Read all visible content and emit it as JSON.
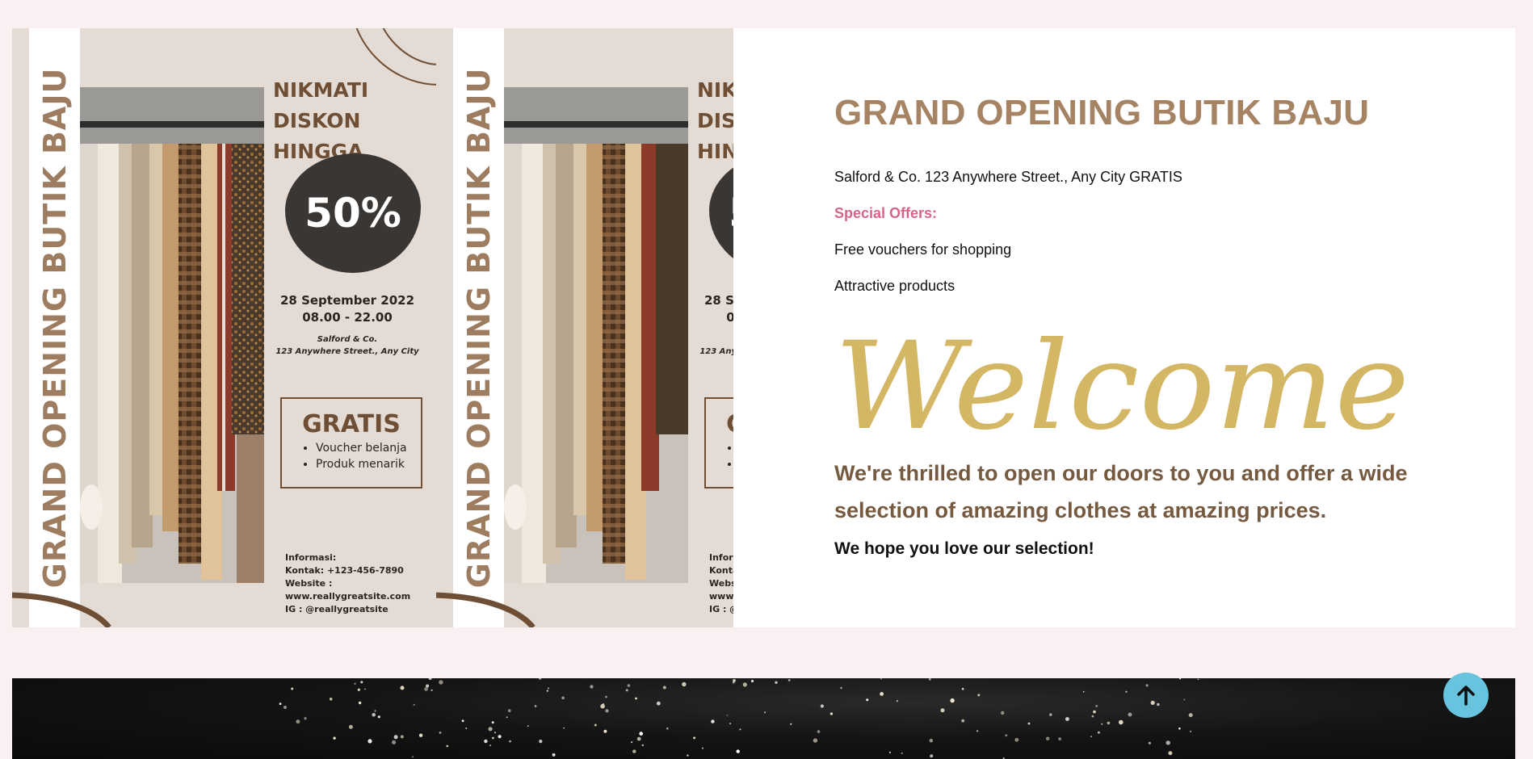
{
  "flyer": {
    "vertical_title": "GRAND OPENING BUTIK BAJU",
    "promo_line1": "NIKMATI",
    "promo_line2": "DISKON HINGGA",
    "discount": "50%",
    "date": "28 September 2022",
    "time": "08.00 - 22.00",
    "venue_name": "Salford & Co.",
    "venue_address": "123 Anywhere Street., Any City",
    "gratis_title": "GRATIS",
    "gratis_items": [
      "Voucher belanja",
      "Produk menarik"
    ],
    "info_lines": [
      "Informasi:",
      "Kontak: +123-456-7890",
      "Website :",
      "www.reallygreatsite.com",
      "IG : @reallygreatsite"
    ],
    "colors": {
      "background": "#e3dbd4",
      "brand_brown": "#6e4f35",
      "title_brown": "#9d7c60",
      "blob": "#3a3634"
    }
  },
  "content": {
    "headline": "GRAND OPENING BUTIK BAJU",
    "address": "Salford & Co. 123 Anywhere Street., Any City GRATIS",
    "special_offers_label": "Special Offers:",
    "offers": [
      "Free vouchers for shopping",
      "Attractive products"
    ],
    "welcome_script": "Welcome",
    "thrilled": "We're thrilled to open our doors to you and offer a wide selection of amazing clothes at amazing prices.",
    "hope": "We hope you love our selection!",
    "colors": {
      "headline": "#a68463",
      "offers_label": "#d5648a",
      "welcome": "#d4b765",
      "thrilled": "#765a40"
    }
  },
  "back_to_top": {
    "icon": "arrow-up-icon",
    "color": "#67c3de"
  },
  "page": {
    "background": "#fbf0f1"
  }
}
